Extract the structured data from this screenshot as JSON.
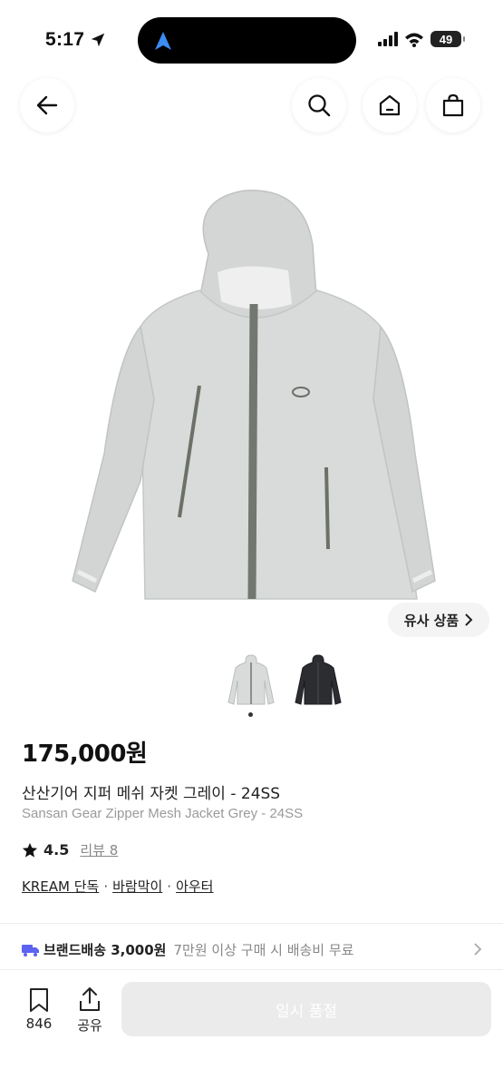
{
  "status_bar": {
    "time": "5:17",
    "battery": "49"
  },
  "nav": {
    "back_icon": "arrow-left-icon",
    "search_icon": "search-icon",
    "home_icon": "home-icon",
    "bag_icon": "shopping-bag-icon"
  },
  "gallery": {
    "similar_label": "유사 상품",
    "thumbnails": [
      "grey-jacket",
      "black-jacket"
    ],
    "current_index": 1,
    "total": 1
  },
  "product": {
    "price": "175,000원",
    "name_ko": "산산기어 지퍼 메쉬 자켓 그레이 - 24SS",
    "name_en": "Sansan Gear Zipper Mesh Jacket Grey - 24SS",
    "rating": "4.5",
    "review_label": "리뷰 8",
    "tags": [
      "KREAM 단독",
      "바람막이",
      "아우터"
    ],
    "tag_separator": "·"
  },
  "shipping": {
    "label": "브랜드배송 3,000원",
    "condition": "7만원 이상 구매 시 배송비 무료"
  },
  "bottom_bar": {
    "bookmark_count": "846",
    "share_label": "공유",
    "soldout_label": "일시 품절"
  },
  "colors": {
    "accent_truck": "#5b63f0",
    "disabled_button": "#ebebeb"
  }
}
